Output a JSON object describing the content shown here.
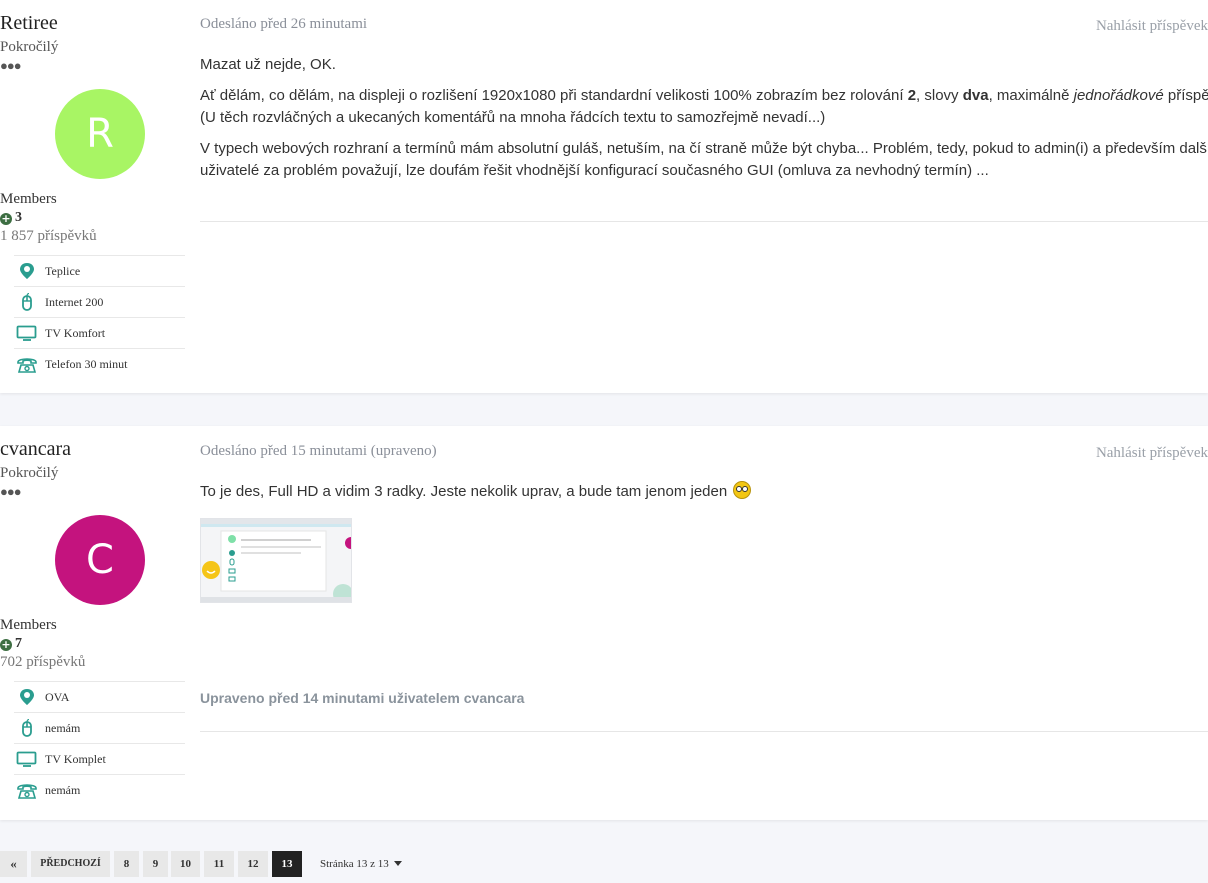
{
  "posts": [
    {
      "author": {
        "name": "Retiree",
        "rank": "Pokročilý",
        "rank_dots": "●●●",
        "avatar_letter": "R",
        "avatar_color": "#a8f564",
        "group": "Members",
        "reputation": "3",
        "post_count": "1 857 příspěvků",
        "info": [
          {
            "icon": "location-pin-icon",
            "label": "Teplice"
          },
          {
            "icon": "mouse-icon",
            "label": "Internet 200"
          },
          {
            "icon": "tv-icon",
            "label": "TV Komfort"
          },
          {
            "icon": "phone-icon",
            "label": "Telefon 30 minut"
          }
        ]
      },
      "meta": "Odesláno před 26 minutami",
      "report": "Nahlásit příspěvek",
      "content": {
        "p1": "Mazat už nejde, OK.",
        "p2_a": "Ať dělám, co dělám, na displeji o rozlišení 1920x1080 při standardní velikosti 100% zobrazím bez rolování ",
        "p2_b": "2",
        "p2_c": ", slovy ",
        "p2_d": "dva",
        "p2_e": ", maximálně ",
        "p2_f": "jednořádkové",
        "p2_g": " příspěvky.",
        "p2_line2": "(U těch rozvláčných a ukecaných komentářů na mnoha řádcích textu to samozřejmě nevadí...)",
        "p3_line1": "V typech webových rozhraní a termínů mám absolutní guláš, netuším, na čí straně může být chyba... Problém, tedy, pokud to admin(i) a především další",
        "p3_line2": "uživatelé za problém považují, lze doufám řešit vhodnější konfigurací současného GUI (omluva za nevhodný termín) ..."
      }
    },
    {
      "author": {
        "name": "cvancara",
        "rank": "Pokročilý",
        "rank_dots": "●●●",
        "avatar_letter": "C",
        "avatar_color": "#c4137e",
        "group": "Members",
        "reputation": "7",
        "post_count": "702 příspěvků",
        "info": [
          {
            "icon": "location-pin-icon",
            "label": "OVA"
          },
          {
            "icon": "mouse-icon",
            "label": "nemám"
          },
          {
            "icon": "tv-icon",
            "label": "TV Komplet"
          },
          {
            "icon": "phone-icon",
            "label": "nemám"
          }
        ]
      },
      "meta": "Odesláno před 15 minutami (upraveno)",
      "report": "Nahlásit příspěvek",
      "content": {
        "p1": "To je des, Full HD a vidim 3 radky. Jeste nekolik uprav, a bude tam jenom jeden"
      },
      "attachment": "screenshot-thumbnail",
      "edited": "Upraveno před 14 minutami uživatelem cvancara"
    }
  ],
  "pagination": {
    "first": "«",
    "prev": "PŘEDCHOZÍ",
    "pages": [
      "8",
      "9",
      "10",
      "11",
      "12",
      "13"
    ],
    "current": "13",
    "page_info": "Stránka 13 z 13"
  },
  "colors": {
    "accent": "#2a9d8f",
    "background": "#f5f6fa"
  }
}
